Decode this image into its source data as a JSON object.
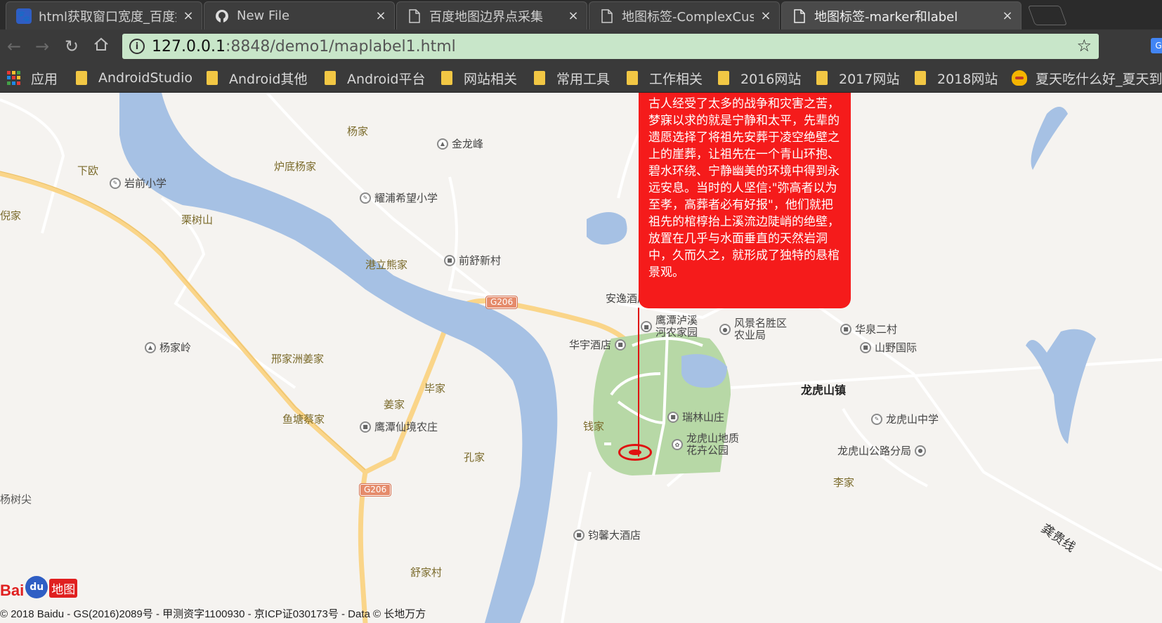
{
  "browser": {
    "tabs": [
      {
        "title": "html获取窗口宽度_百度提",
        "icon": "baidu-paw-icon",
        "active": false
      },
      {
        "title": "New File",
        "icon": "github-icon",
        "active": false
      },
      {
        "title": "百度地图边界点采集",
        "icon": "page-icon",
        "active": false
      },
      {
        "title": "地图标签-ComplexCusto",
        "icon": "page-icon",
        "active": false
      },
      {
        "title": "地图标签-marker和label",
        "icon": "page-icon",
        "active": true
      }
    ],
    "close_glyph": "×",
    "url_host": "127.0.0.1",
    "url_rest": ":8848/demo1/maplabel1.html",
    "bookmarks": [
      {
        "label": "应用",
        "type": "apps"
      },
      {
        "label": "AndroidStudio",
        "type": "folder"
      },
      {
        "label": "Android其他",
        "type": "folder"
      },
      {
        "label": "Android平台",
        "type": "folder"
      },
      {
        "label": "网站相关",
        "type": "folder"
      },
      {
        "label": "常用工具",
        "type": "folder"
      },
      {
        "label": "工作相关",
        "type": "folder"
      },
      {
        "label": "2016网站",
        "type": "folder"
      },
      {
        "label": "2017网站",
        "type": "folder"
      },
      {
        "label": "2018网站",
        "type": "folder"
      },
      {
        "label": "夏天吃什么好_夏天到",
        "type": "site"
      }
    ]
  },
  "map": {
    "label_text": "古人经受了太多的战争和灾害之苦，梦寐以求的就是宁静和太平，先辈的遗愿选择了将祖先安葬于凌空绝壁之上的崖葬，让祖先在一个青山环抱、碧水环绕、宁静幽美的环境中得到永远安息。当时的人坚信:\"弥高者以为至孝，高葬者必有好报\"，他们就把祖先的棺椁抬上溪流边陡峭的绝壁，放置在几乎与水面垂直的天然岩洞中，久而久之，就形成了独特的悬棺景观。",
    "pois": [
      {
        "name": "金龙峰",
        "icon": "mountain-icon"
      },
      {
        "name": "岩前小学",
        "icon": "school-icon"
      },
      {
        "name": "耀浦希望小学",
        "icon": "school-icon"
      },
      {
        "name": "前舒新村",
        "icon": "building-icon"
      },
      {
        "name": "安逸酒店",
        "icon": "hotel-icon"
      },
      {
        "name": "鹰潭泸溪\n河农家园",
        "icon": "building-icon"
      },
      {
        "name": "风景名胜区\n农业局",
        "icon": "government-icon"
      },
      {
        "name": "华泉二村",
        "icon": "building-icon"
      },
      {
        "name": "山野国际",
        "icon": "building-icon"
      },
      {
        "name": "华宇酒店",
        "icon": "hotel-icon"
      },
      {
        "name": "杨家岭",
        "icon": "mountain-icon"
      },
      {
        "name": "鹰潭仙境农庄",
        "icon": "building-icon"
      },
      {
        "name": "瑞林山庄",
        "icon": "building-icon"
      },
      {
        "name": "龙虎山地质\n花卉公园",
        "icon": "park-icon"
      },
      {
        "name": "龙虎山中学",
        "icon": "school-icon"
      },
      {
        "name": "龙虎山公路分局",
        "icon": "government-icon"
      },
      {
        "name": "钧馨大酒店",
        "icon": "hotel-icon"
      }
    ],
    "villages": [
      "杨家",
      "下欧",
      "炉底杨家",
      "倪家",
      "栗树山",
      "港立熊家",
      "邢家洲姜家",
      "毕家",
      "姜家",
      "鱼塘蔡家",
      "钱家",
      "孔家",
      "李家",
      "杨树尖",
      "舒家村"
    ],
    "towns": [
      "龙虎山镇"
    ],
    "road_shields": [
      "G206",
      "G206"
    ],
    "road_names": [
      "龚贵线"
    ],
    "logo": {
      "bai": "Bai",
      "du": "du",
      "ditu": "地图"
    },
    "copyright": "© 2018 Baidu - GS(2016)2089号 - 甲测资字1100930 - 京ICP证030173号 - Data © 长地万方"
  }
}
